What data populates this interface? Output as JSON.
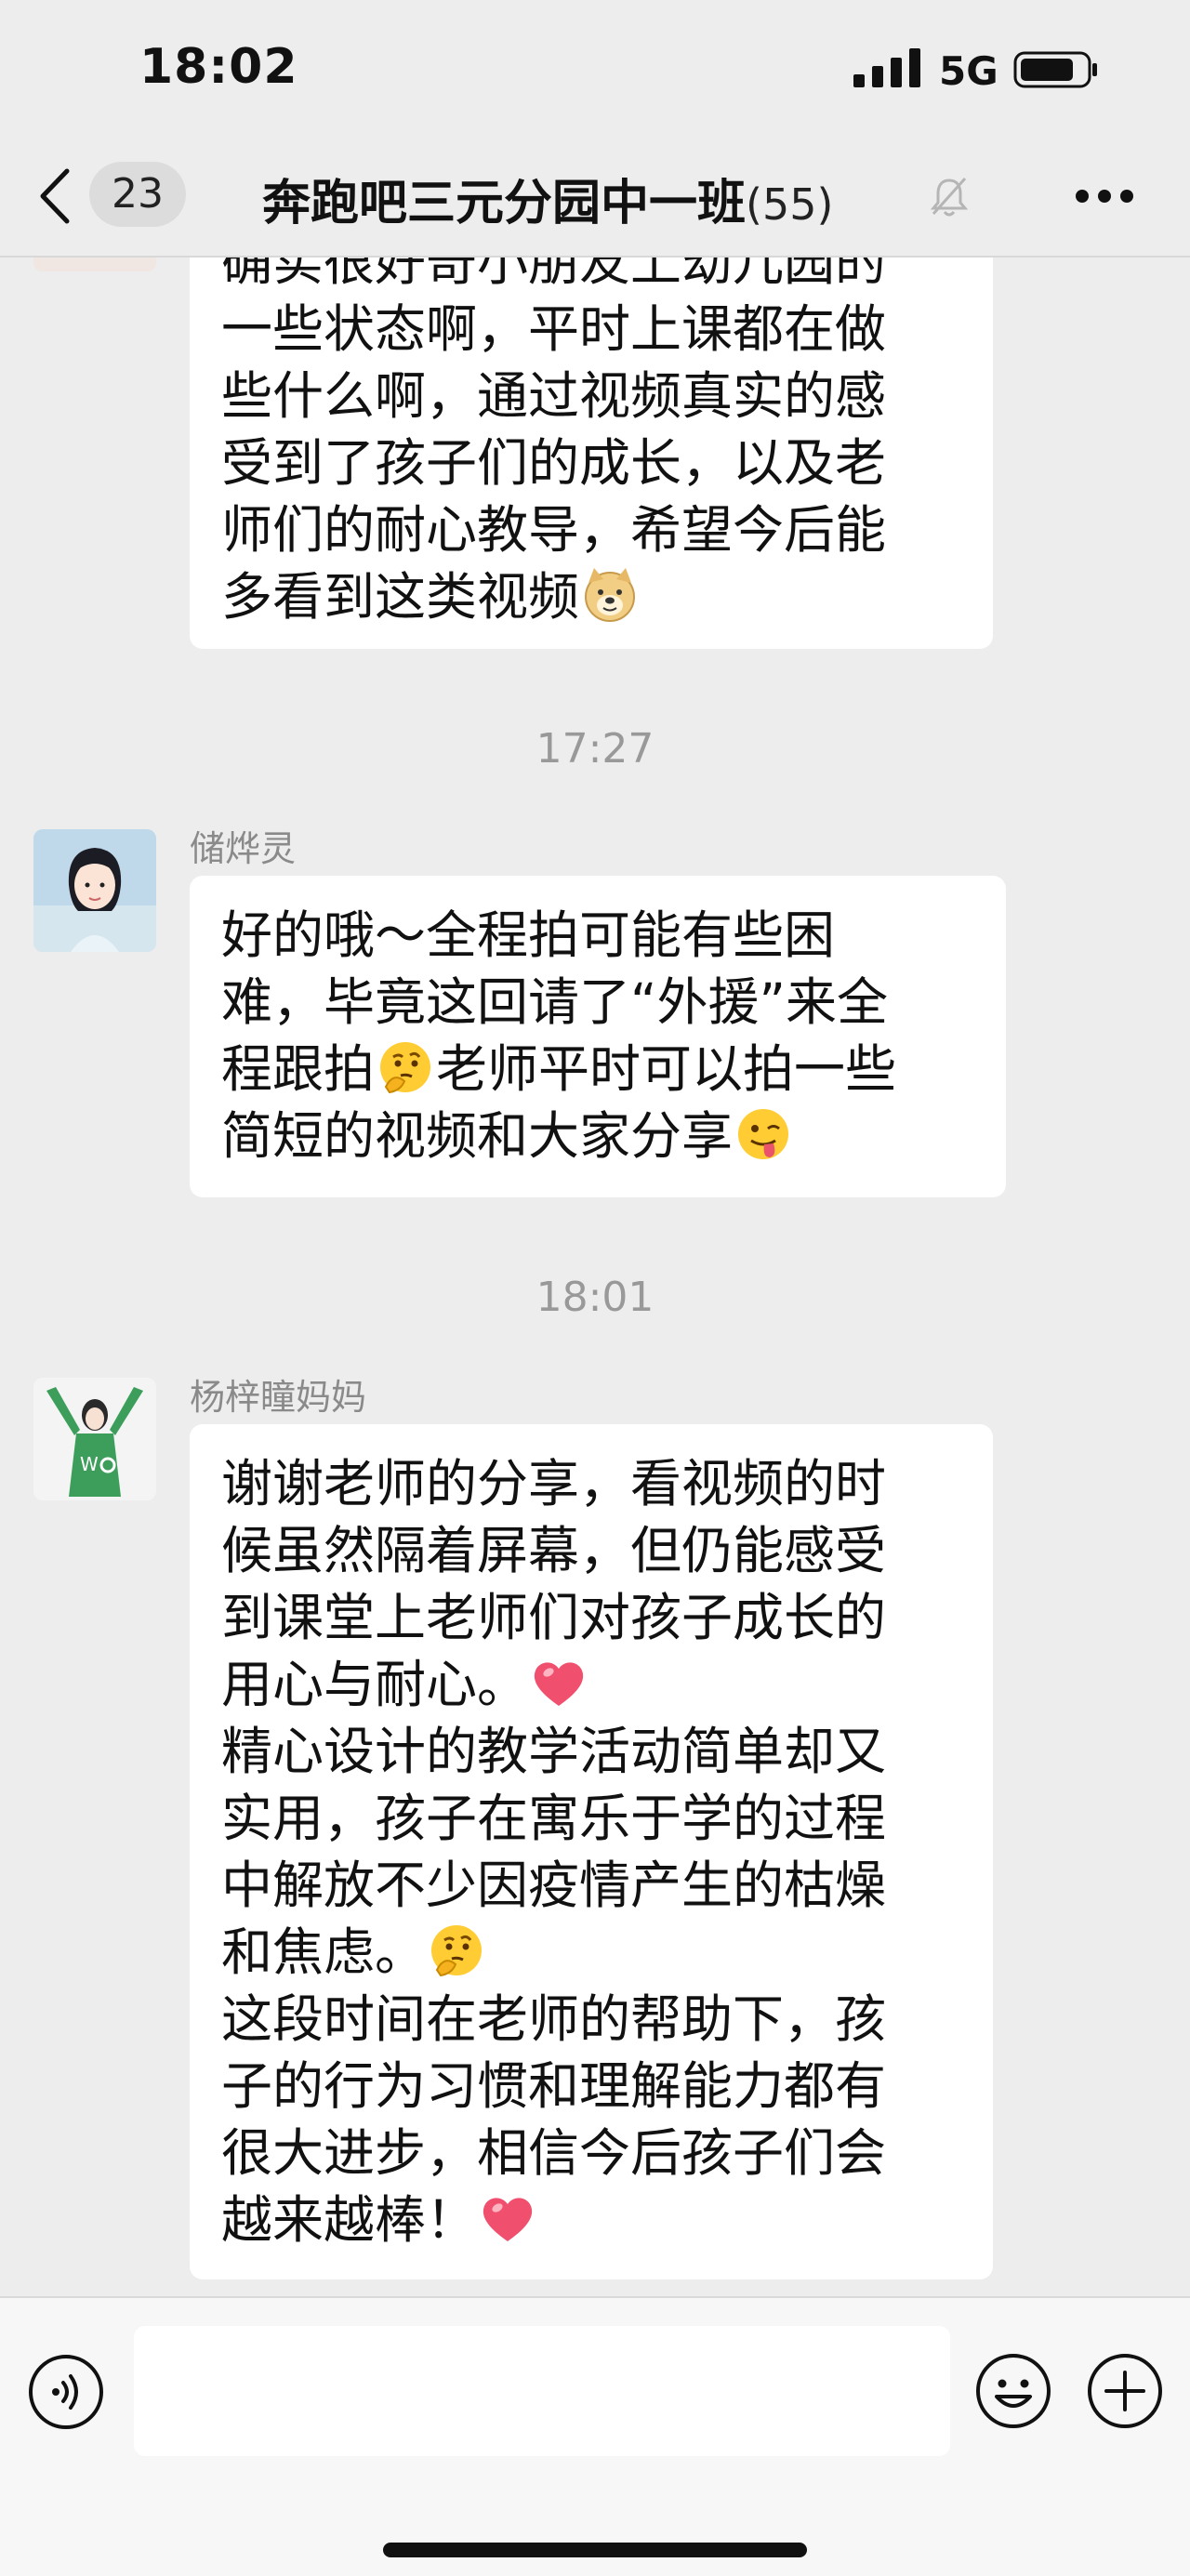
{
  "status_bar": {
    "time": "18:02",
    "network": "5G"
  },
  "nav": {
    "unread_count": "23",
    "chat_title": "奔跑吧三元分园中一班",
    "member_count": "(55)"
  },
  "messages": [
    {
      "sender": "",
      "lines": [
        "确实很好奇小朋友上幼儿园的",
        "一些状态啊，平时上课都在做",
        "些什么啊，通过视频真实的感",
        "受到了孩子们的成长，以及老",
        "师们的耐心教导，希望今后能",
        "多看到这类视频"
      ],
      "trailing_emoji": "doge"
    },
    {
      "timestamp": "17:27",
      "sender": "储烨灵",
      "line1": "好的哦～全程拍可能有些困",
      "line2": "难，毕竟这回请了“外援”来全",
      "line3a": "程跟拍",
      "line3b": "老师平时可以拍一些",
      "line4": "简短的视频和大家分享",
      "emoji_a": "thinking-face",
      "emoji_b": "winking-tongue-face"
    },
    {
      "timestamp": "18:01",
      "sender": "杨梓瞳妈妈",
      "lines": [
        "谢谢老师的分享，看视频的时",
        "候虽然隔着屏幕，但仍能感受",
        "到课堂上老师们对孩子成长的",
        "用心与耐心。",
        "精心设计的教学活动简单却又",
        "实用，孩子在寓乐于学的过程",
        "中解放不少因疫情产生的枯燥",
        "和焦虑。",
        "这段时间在老师的帮助下，孩",
        "子的行为习惯和理解能力都有",
        "很大进步，相信今后孩子们会",
        "越来越棒！"
      ],
      "emoji_names": [
        "heart",
        "thinking-face",
        "heart"
      ]
    }
  ],
  "input": {
    "placeholder": ""
  },
  "colors": {
    "background": "#EDEDED",
    "bubble": "#FFFFFF",
    "timestamp": "#999999",
    "heart": "#F0506E"
  }
}
